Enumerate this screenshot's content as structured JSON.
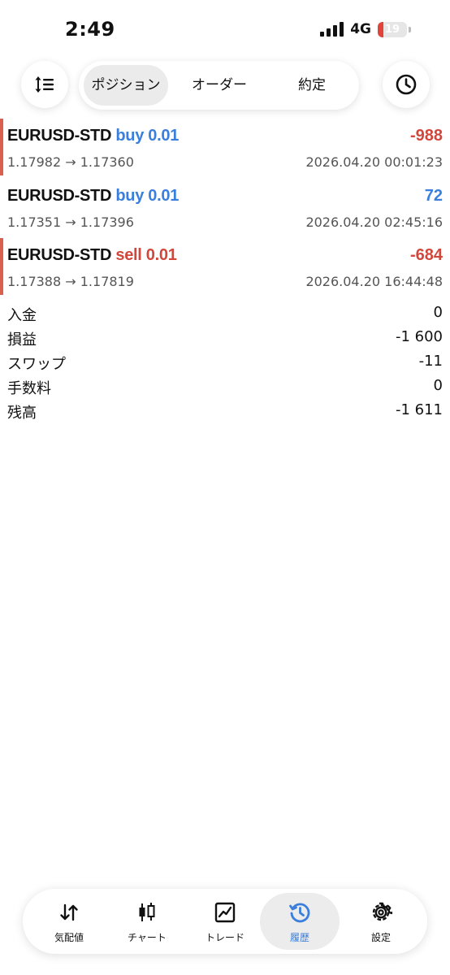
{
  "status": {
    "time": "2:49",
    "network": "4G",
    "battery": "19"
  },
  "colors": {
    "buy": "#3a7fdc",
    "sell": "#d2473c",
    "accent": "#3a7fdc",
    "closed_marker": "#d9604f"
  },
  "toolbar": {
    "sort_icon": "sort-icon",
    "history_period_icon": "clock-icon",
    "tabs": [
      {
        "label": "ポジション",
        "active": true
      },
      {
        "label": "オーダー",
        "active": false
      },
      {
        "label": "約定",
        "active": false
      }
    ]
  },
  "deals": [
    {
      "symbol": "EURUSD-STD",
      "side": "buy 0.01",
      "profit": "-988",
      "prices": "1.17982 → 1.17360",
      "time": "2026.04.20 00:01:23"
    },
    {
      "symbol": "EURUSD-STD",
      "side": "buy 0.01",
      "profit": "72",
      "prices": "1.17351 → 1.17396",
      "time": "2026.04.20 02:45:16"
    },
    {
      "symbol": "EURUSD-STD",
      "side": "sell 0.01",
      "profit": "-684",
      "prices": "1.17388 → 1.17819",
      "time": "2026.04.20 16:44:48"
    }
  ],
  "summary": [
    {
      "label": "入金",
      "value": "0"
    },
    {
      "label": "損益",
      "value": "-1 600"
    },
    {
      "label": "スワップ",
      "value": "-11"
    },
    {
      "label": "手数料",
      "value": "0"
    },
    {
      "label": "残高",
      "value": "-1 611"
    }
  ],
  "nav": [
    {
      "label": "気配値",
      "icon": "quotes-icon",
      "active": false
    },
    {
      "label": "チャート",
      "icon": "chart-icon",
      "active": false
    },
    {
      "label": "トレード",
      "icon": "trade-icon",
      "active": false
    },
    {
      "label": "履歴",
      "icon": "history-icon",
      "active": true
    },
    {
      "label": "設定",
      "icon": "settings-icon",
      "active": false
    }
  ]
}
